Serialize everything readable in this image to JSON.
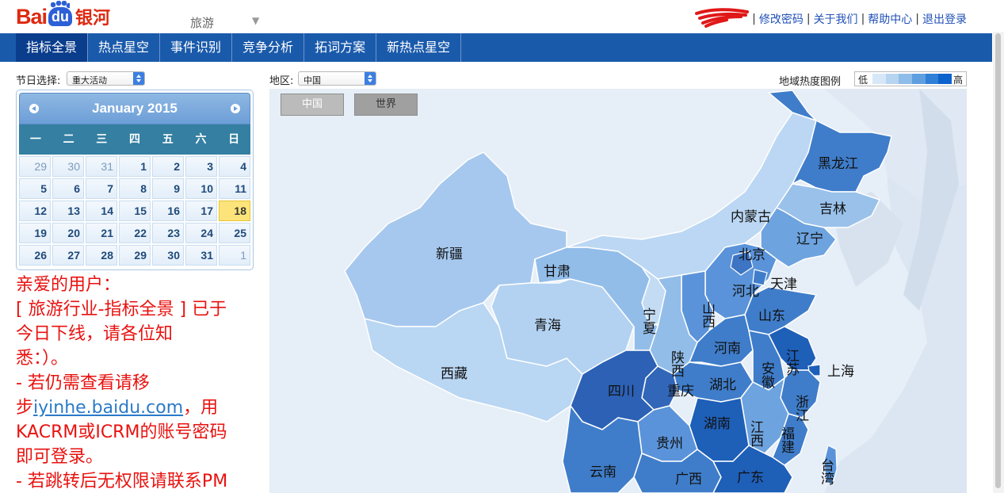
{
  "header": {
    "logo_text_bai": "Bai",
    "logo_text_du": "du",
    "logo_text_cn": "银河",
    "industry_select": "旅游",
    "links": [
      "修改密码",
      "关于我们",
      "帮助中心",
      "退出登录"
    ],
    "separator": "|"
  },
  "nav": {
    "tabs": [
      {
        "label": "指标全景",
        "active": true
      },
      {
        "label": "热点星空",
        "active": false
      },
      {
        "label": "事件识别",
        "active": false
      },
      {
        "label": "竞争分析",
        "active": false
      },
      {
        "label": "拓词方案",
        "active": false
      },
      {
        "label": "新热点星空",
        "active": false
      }
    ]
  },
  "filters": {
    "festival_label": "节日选择:",
    "festival_value": "重大活动",
    "region_label": "地区:",
    "region_value": "中国"
  },
  "calendar": {
    "title": "January 2015",
    "weekdays": [
      "一",
      "二",
      "三",
      "四",
      "五",
      "六",
      "日"
    ],
    "days": [
      [
        "29",
        "30",
        "31",
        "1",
        "2",
        "3",
        "4"
      ],
      [
        "5",
        "6",
        "7",
        "8",
        "9",
        "10",
        "11"
      ],
      [
        "12",
        "13",
        "14",
        "15",
        "16",
        "17",
        "18"
      ],
      [
        "19",
        "20",
        "21",
        "22",
        "23",
        "24",
        "25"
      ],
      [
        "26",
        "27",
        "28",
        "29",
        "30",
        "31",
        "1"
      ]
    ],
    "today": "18"
  },
  "notice": {
    "lines": [
      "亲爱的用户：",
      "[ 旅游行业-指标全景 ] 已于",
      "今日下线，请各位知",
      "悉：）。",
      "- 若仍需查看请移"
    ],
    "line_link_prefix": "步",
    "link": "iyinhe.baidu.com",
    "line_link_suffix": "，用",
    "lines_after": [
      "KACRM或ICRM的账号密码",
      "即可登录。",
      "- 若跳转后无权限请联系PM"
    ]
  },
  "map": {
    "scope_buttons": [
      "中国",
      "世界"
    ],
    "legend_title": "地域热度图例",
    "legend_low": "低",
    "legend_high": "高",
    "legend_colors": [
      "#d6e7f7",
      "#b7d4f0",
      "#8ebde9",
      "#5f9fe0",
      "#2f7fd6",
      "#0d63cc"
    ],
    "provinces": [
      "黑龙江",
      "吉林",
      "辽宁",
      "内蒙古",
      "北京",
      "天津",
      "河北",
      "山西",
      "山东",
      "新疆",
      "甘肃",
      "宁夏",
      "青海",
      "陕西",
      "河南",
      "江苏",
      "安徽",
      "上海",
      "西藏",
      "四川",
      "重庆",
      "湖北",
      "浙江",
      "湖南",
      "江西",
      "福建",
      "贵州",
      "云南",
      "广西",
      "广东",
      "台湾"
    ]
  }
}
